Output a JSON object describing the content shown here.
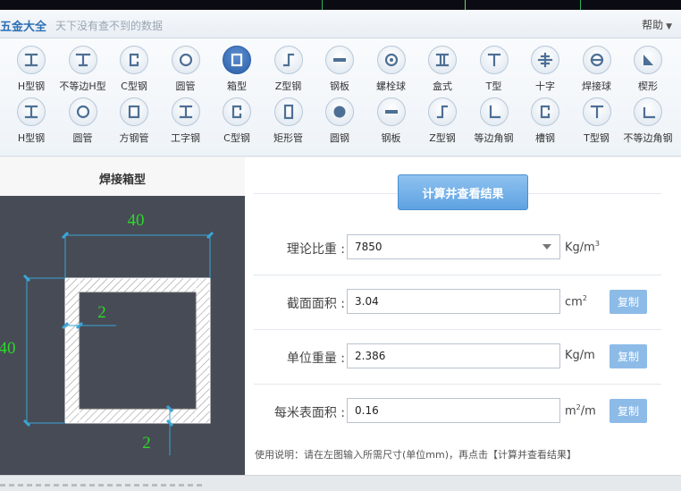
{
  "header": {
    "title": "五金大全",
    "subtitle": "天下没有查不到的数据",
    "help_label": "帮助"
  },
  "toolbar": {
    "row1": [
      {
        "label": "H型钢",
        "icon": "h-beam-icon"
      },
      {
        "label": "不等边H型",
        "icon": "unequal-h-beam-icon"
      },
      {
        "label": "C型钢",
        "icon": "c-channel-icon"
      },
      {
        "label": "圆管",
        "icon": "round-tube-icon"
      },
      {
        "label": "箱型",
        "icon": "box-section-icon",
        "active": true
      },
      {
        "label": "Z型钢",
        "icon": "z-section-icon"
      },
      {
        "label": "钢板",
        "icon": "steel-plate-icon"
      },
      {
        "label": "螺栓球",
        "icon": "bolt-ball-icon"
      },
      {
        "label": "盒式",
        "icon": "box-type-icon"
      },
      {
        "label": "T型",
        "icon": "t-section-icon"
      },
      {
        "label": "十字",
        "icon": "cross-section-icon"
      },
      {
        "label": "焊接球",
        "icon": "welded-ball-icon"
      },
      {
        "label": "楔形",
        "icon": "wedge-icon"
      }
    ],
    "row2": [
      {
        "label": "H型钢",
        "icon": "h-beam-icon"
      },
      {
        "label": "圆管",
        "icon": "round-tube-icon"
      },
      {
        "label": "方钢管",
        "icon": "square-tube-icon"
      },
      {
        "label": "工字钢",
        "icon": "i-beam-icon"
      },
      {
        "label": "C型钢",
        "icon": "c-channel-icon"
      },
      {
        "label": "矩形管",
        "icon": "rect-tube-icon"
      },
      {
        "label": "圆钢",
        "icon": "round-bar-icon"
      },
      {
        "label": "钢板",
        "icon": "steel-plate-icon"
      },
      {
        "label": "Z型钢",
        "icon": "z-section-icon"
      },
      {
        "label": "等边角钢",
        "icon": "equal-angle-icon"
      },
      {
        "label": "槽钢",
        "icon": "channel-icon"
      },
      {
        "label": "T型钢",
        "icon": "t-section-icon"
      },
      {
        "label": "不等边角钢",
        "icon": "unequal-angle-icon"
      }
    ]
  },
  "left": {
    "title": "焊接箱型",
    "dims": {
      "top": "40",
      "left": "40",
      "inner": "2",
      "bottom": "2"
    }
  },
  "right": {
    "calc_label": "计算并查看结果",
    "rows": [
      {
        "label": "理论比重 :",
        "value": "7850",
        "unit": "Kg/m",
        "unit_sup": "3",
        "dropdown": true
      },
      {
        "label": "截面面积 :",
        "value": "3.04",
        "unit": "cm",
        "unit_sup": "2",
        "copy": "复制"
      },
      {
        "label": "单位重量 :",
        "value": "2.386",
        "unit": "Kg/m",
        "unit_sup": "",
        "copy": "复制"
      },
      {
        "label": "每米表面积 :",
        "value": "0.16",
        "unit": "m",
        "unit_sup": "2",
        "unit_tail": "/m",
        "copy": "复制"
      }
    ],
    "usage": "使用说明：请在左图输入所需尺寸(单位mm)，再点击【计算并查看结果】"
  },
  "colors": {
    "accent": "#5ea2e2",
    "diagram_bg": "#474b55",
    "dimension_line": "#39a6d8",
    "dimension_text": "#2bd92b"
  }
}
